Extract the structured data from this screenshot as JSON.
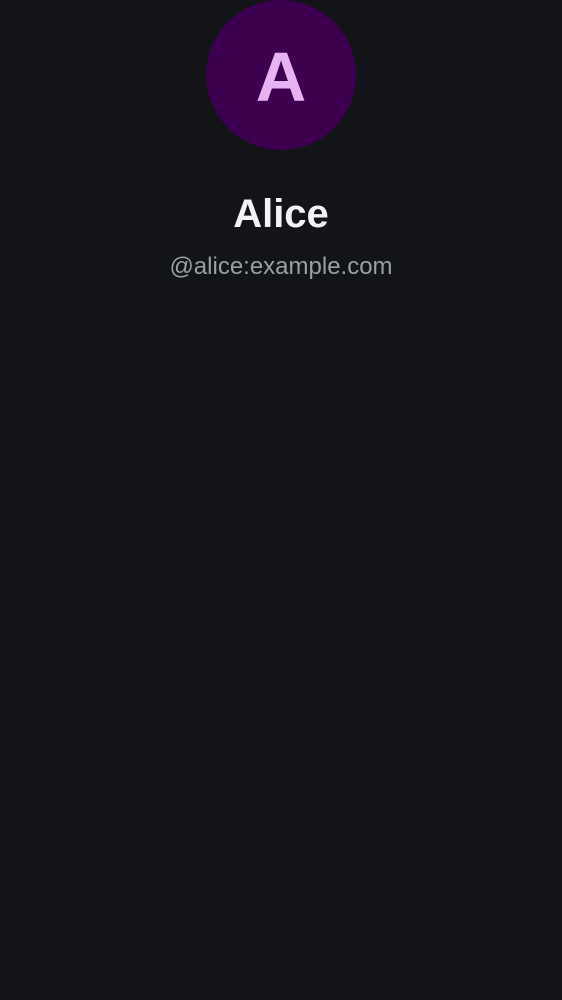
{
  "profile": {
    "avatar_initial": "A",
    "display_name": "Alice",
    "user_id": "@alice:example.com"
  },
  "colors": {
    "background": "#121418",
    "avatar_background": "#3d0050",
    "avatar_text": "#e7b3f3",
    "name_text": "#f2f3f5",
    "user_id_text": "#9a9fa6"
  }
}
